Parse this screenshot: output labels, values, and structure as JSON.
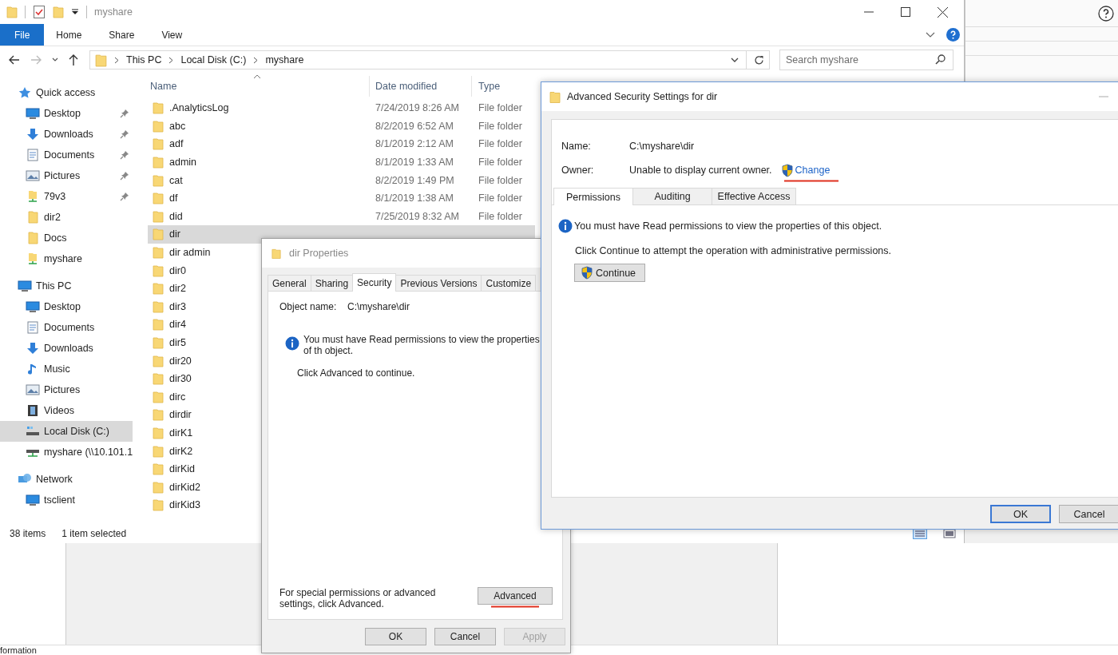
{
  "explorer": {
    "title": "myshare",
    "ribbon_tabs": [
      {
        "label": "File",
        "selected": true
      },
      {
        "label": "Home",
        "selected": false
      },
      {
        "label": "Share",
        "selected": false
      },
      {
        "label": "View",
        "selected": false
      }
    ],
    "breadcrumb": [
      "This PC",
      "Local Disk (C:)",
      "myshare"
    ],
    "search": {
      "placeholder": "Search myshare"
    },
    "columns": [
      "Name",
      "Date modified",
      "Type"
    ],
    "navigation": [
      {
        "label": "Quick access",
        "kind": "star",
        "selected": false,
        "children": [
          {
            "label": "Desktop",
            "kind": "desktop",
            "pinned": true,
            "selected": false
          },
          {
            "label": "Downloads",
            "kind": "downloads",
            "pinned": true,
            "selected": false
          },
          {
            "label": "Documents",
            "kind": "documents",
            "pinned": true,
            "selected": false
          },
          {
            "label": "Pictures",
            "kind": "pictures",
            "pinned": true,
            "selected": false
          },
          {
            "label": "79v3",
            "kind": "share",
            "pinned": true,
            "selected": false
          },
          {
            "label": "dir2",
            "kind": "folder",
            "pinned": false,
            "selected": false
          },
          {
            "label": "Docs",
            "kind": "folder",
            "pinned": false,
            "selected": false
          },
          {
            "label": "myshare",
            "kind": "share",
            "pinned": false,
            "selected": false
          }
        ]
      },
      {
        "label": "This PC",
        "kind": "pc",
        "selected": false,
        "children": [
          {
            "label": "Desktop",
            "kind": "desktop",
            "pinned": false,
            "selected": false
          },
          {
            "label": "Documents",
            "kind": "documents",
            "pinned": false,
            "selected": false
          },
          {
            "label": "Downloads",
            "kind": "downloads",
            "pinned": false,
            "selected": false
          },
          {
            "label": "Music",
            "kind": "music",
            "pinned": false,
            "selected": false
          },
          {
            "label": "Pictures",
            "kind": "pictures",
            "pinned": false,
            "selected": false
          },
          {
            "label": "Videos",
            "kind": "videos",
            "pinned": false,
            "selected": false
          },
          {
            "label": "Local Disk (C:)",
            "kind": "drive",
            "pinned": false,
            "selected": true
          },
          {
            "label": "myshare (\\\\10.101.1",
            "kind": "netdrive",
            "pinned": false,
            "selected": false
          }
        ]
      },
      {
        "label": "Network",
        "kind": "network",
        "selected": false,
        "children": [
          {
            "label": "tsclient",
            "kind": "desktop",
            "pinned": false,
            "selected": false
          }
        ]
      }
    ],
    "files": [
      {
        "name": ".AnalyticsLog",
        "date": "7/24/2019 8:26 AM",
        "type": "File folder",
        "selected": false
      },
      {
        "name": "abc",
        "date": "8/2/2019 6:52 AM",
        "type": "File folder",
        "selected": false
      },
      {
        "name": "adf",
        "date": "8/1/2019 2:12 AM",
        "type": "File folder",
        "selected": false
      },
      {
        "name": "admin",
        "date": "8/1/2019 1:33 AM",
        "type": "File folder",
        "selected": false
      },
      {
        "name": "cat",
        "date": "8/2/2019 1:49 PM",
        "type": "File folder",
        "selected": false
      },
      {
        "name": "df",
        "date": "8/1/2019 1:38 AM",
        "type": "File folder",
        "selected": false
      },
      {
        "name": "did",
        "date": "7/25/2019 8:32 AM",
        "type": "File folder",
        "selected": false
      },
      {
        "name": "dir",
        "selected": true
      },
      {
        "name": "dir admin",
        "selected": false
      },
      {
        "name": "dir0",
        "selected": false
      },
      {
        "name": "dir2",
        "selected": false
      },
      {
        "name": "dir3",
        "selected": false
      },
      {
        "name": "dir4",
        "selected": false
      },
      {
        "name": "dir5",
        "selected": false
      },
      {
        "name": "dir20",
        "selected": false
      },
      {
        "name": "dir30",
        "selected": false
      },
      {
        "name": "dirc",
        "selected": false
      },
      {
        "name": "dirdir",
        "selected": false
      },
      {
        "name": "dirK1",
        "selected": false
      },
      {
        "name": "dirK2",
        "selected": false
      },
      {
        "name": "dirKid",
        "selected": false
      },
      {
        "name": "dirKid2",
        "selected": false
      },
      {
        "name": "dirKid3",
        "selected": false
      }
    ],
    "status": {
      "count": "38 items",
      "selection": "1 item selected"
    }
  },
  "properties_dialog": {
    "title": "dir Properties",
    "tabs": [
      {
        "label": "General",
        "selected": false
      },
      {
        "label": "Sharing",
        "selected": false
      },
      {
        "label": "Security",
        "selected": true
      },
      {
        "label": "Previous Versions",
        "selected": false
      },
      {
        "label": "Customize",
        "selected": false
      }
    ],
    "object_label": "Object name:",
    "object_value": "C:\\myshare\\dir",
    "info": "You must have Read permissions to view the properties of th object.",
    "hint": "Click Advanced to continue.",
    "advanced_text": "For special permissions or advanced settings, click Advanced.",
    "advanced_button": "Advanced",
    "buttons": [
      {
        "label": "OK",
        "disabled": false
      },
      {
        "label": "Cancel",
        "disabled": false
      },
      {
        "label": "Apply",
        "disabled": true
      }
    ]
  },
  "security_dialog": {
    "title": "Advanced Security Settings for dir",
    "name_label": "Name:",
    "name_value": "C:\\myshare\\dir",
    "owner_label": "Owner:",
    "owner_value": "Unable to display current owner.",
    "owner_link": "Change",
    "tabs": [
      {
        "label": "Permissions",
        "selected": true
      },
      {
        "label": "Auditing",
        "selected": false
      },
      {
        "label": "Effective Access",
        "selected": false
      }
    ],
    "info": "You must have Read permissions to view the properties of this object.",
    "hint": "Click Continue to attempt the operation with administrative permissions.",
    "continue_button": "Continue",
    "buttons": [
      {
        "label": "OK",
        "default": true
      },
      {
        "label": "Cancel",
        "default": false
      }
    ]
  },
  "background_window": {
    "status_text": "formation"
  }
}
